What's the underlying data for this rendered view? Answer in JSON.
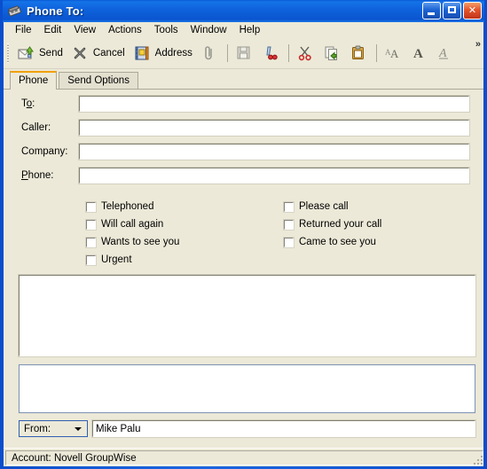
{
  "window": {
    "title": "Phone To:",
    "icon": "phone-window-icon",
    "buttons": {
      "minimize": "Minimize",
      "maximize": "Maximize",
      "close": "Close"
    }
  },
  "menubar": {
    "items": [
      {
        "label": "File"
      },
      {
        "label": "Edit"
      },
      {
        "label": "View"
      },
      {
        "label": "Actions"
      },
      {
        "label": "Tools"
      },
      {
        "label": "Window"
      },
      {
        "label": "Help"
      }
    ]
  },
  "toolbar": {
    "send_label": "Send",
    "cancel_label": "Cancel",
    "address_label": "Address",
    "attach_icon": "paperclip-icon",
    "save_icon": "save-icon",
    "spellcheck_icon": "spellcheck-icon",
    "cut_icon": "scissors-icon",
    "copy_icon": "copy-icon",
    "paste_icon": "clipboard-paste-icon",
    "fontsize_icon": "font-size-icon",
    "bold_icon": "bold-icon",
    "italic_icon": "italic-underline-icon",
    "overflow_label": "»"
  },
  "tabs": [
    {
      "label": "Phone",
      "active": true
    },
    {
      "label": "Send Options",
      "active": false
    }
  ],
  "form": {
    "fields": [
      {
        "label_pre": "T",
        "label_hot": "o",
        "label_post": ":",
        "name": "to",
        "value": ""
      },
      {
        "label_pre": "Caller:",
        "label_hot": "",
        "label_post": "",
        "name": "caller",
        "value": ""
      },
      {
        "label_pre": "Company:",
        "label_hot": "",
        "label_post": "",
        "name": "company",
        "value": ""
      },
      {
        "label_pre": "",
        "label_hot": "P",
        "label_post": "hone:",
        "name": "phone",
        "value": ""
      }
    ],
    "checkboxes_left": [
      {
        "label": "Telephoned",
        "checked": false
      },
      {
        "label": "Will call again",
        "checked": false
      },
      {
        "label": "Wants to see you",
        "checked": false
      },
      {
        "label": "Urgent",
        "checked": false
      }
    ],
    "checkboxes_right": [
      {
        "label": "Please call",
        "checked": false
      },
      {
        "label": "Returned your call",
        "checked": false
      },
      {
        "label": "Came to see you",
        "checked": false
      }
    ],
    "message_body": "",
    "attachment_area": ""
  },
  "footer": {
    "from_label": "From:",
    "from_value": "Mike Palu"
  },
  "statusbar": {
    "text": "Account: Novell GroupWise"
  },
  "colors": {
    "title_blue": "#0a55cf",
    "face": "#ece9d8",
    "tab_accent": "#f0a000",
    "close_red": "#e4552b"
  }
}
